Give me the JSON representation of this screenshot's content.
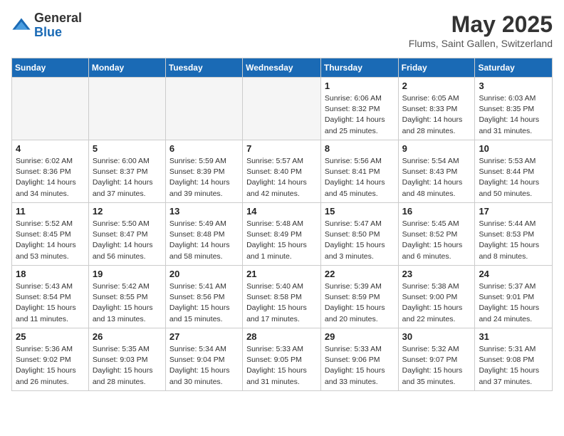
{
  "logo": {
    "general": "General",
    "blue": "Blue"
  },
  "title": "May 2025",
  "location": "Flums, Saint Gallen, Switzerland",
  "weekdays": [
    "Sunday",
    "Monday",
    "Tuesday",
    "Wednesday",
    "Thursday",
    "Friday",
    "Saturday"
  ],
  "weeks": [
    [
      {
        "day": "",
        "text": ""
      },
      {
        "day": "",
        "text": ""
      },
      {
        "day": "",
        "text": ""
      },
      {
        "day": "",
        "text": ""
      },
      {
        "day": "1",
        "text": "Sunrise: 6:06 AM\nSunset: 8:32 PM\nDaylight: 14 hours and 25 minutes."
      },
      {
        "day": "2",
        "text": "Sunrise: 6:05 AM\nSunset: 8:33 PM\nDaylight: 14 hours and 28 minutes."
      },
      {
        "day": "3",
        "text": "Sunrise: 6:03 AM\nSunset: 8:35 PM\nDaylight: 14 hours and 31 minutes."
      }
    ],
    [
      {
        "day": "4",
        "text": "Sunrise: 6:02 AM\nSunset: 8:36 PM\nDaylight: 14 hours and 34 minutes."
      },
      {
        "day": "5",
        "text": "Sunrise: 6:00 AM\nSunset: 8:37 PM\nDaylight: 14 hours and 37 minutes."
      },
      {
        "day": "6",
        "text": "Sunrise: 5:59 AM\nSunset: 8:39 PM\nDaylight: 14 hours and 39 minutes."
      },
      {
        "day": "7",
        "text": "Sunrise: 5:57 AM\nSunset: 8:40 PM\nDaylight: 14 hours and 42 minutes."
      },
      {
        "day": "8",
        "text": "Sunrise: 5:56 AM\nSunset: 8:41 PM\nDaylight: 14 hours and 45 minutes."
      },
      {
        "day": "9",
        "text": "Sunrise: 5:54 AM\nSunset: 8:43 PM\nDaylight: 14 hours and 48 minutes."
      },
      {
        "day": "10",
        "text": "Sunrise: 5:53 AM\nSunset: 8:44 PM\nDaylight: 14 hours and 50 minutes."
      }
    ],
    [
      {
        "day": "11",
        "text": "Sunrise: 5:52 AM\nSunset: 8:45 PM\nDaylight: 14 hours and 53 minutes."
      },
      {
        "day": "12",
        "text": "Sunrise: 5:50 AM\nSunset: 8:47 PM\nDaylight: 14 hours and 56 minutes."
      },
      {
        "day": "13",
        "text": "Sunrise: 5:49 AM\nSunset: 8:48 PM\nDaylight: 14 hours and 58 minutes."
      },
      {
        "day": "14",
        "text": "Sunrise: 5:48 AM\nSunset: 8:49 PM\nDaylight: 15 hours and 1 minute."
      },
      {
        "day": "15",
        "text": "Sunrise: 5:47 AM\nSunset: 8:50 PM\nDaylight: 15 hours and 3 minutes."
      },
      {
        "day": "16",
        "text": "Sunrise: 5:45 AM\nSunset: 8:52 PM\nDaylight: 15 hours and 6 minutes."
      },
      {
        "day": "17",
        "text": "Sunrise: 5:44 AM\nSunset: 8:53 PM\nDaylight: 15 hours and 8 minutes."
      }
    ],
    [
      {
        "day": "18",
        "text": "Sunrise: 5:43 AM\nSunset: 8:54 PM\nDaylight: 15 hours and 11 minutes."
      },
      {
        "day": "19",
        "text": "Sunrise: 5:42 AM\nSunset: 8:55 PM\nDaylight: 15 hours and 13 minutes."
      },
      {
        "day": "20",
        "text": "Sunrise: 5:41 AM\nSunset: 8:56 PM\nDaylight: 15 hours and 15 minutes."
      },
      {
        "day": "21",
        "text": "Sunrise: 5:40 AM\nSunset: 8:58 PM\nDaylight: 15 hours and 17 minutes."
      },
      {
        "day": "22",
        "text": "Sunrise: 5:39 AM\nSunset: 8:59 PM\nDaylight: 15 hours and 20 minutes."
      },
      {
        "day": "23",
        "text": "Sunrise: 5:38 AM\nSunset: 9:00 PM\nDaylight: 15 hours and 22 minutes."
      },
      {
        "day": "24",
        "text": "Sunrise: 5:37 AM\nSunset: 9:01 PM\nDaylight: 15 hours and 24 minutes."
      }
    ],
    [
      {
        "day": "25",
        "text": "Sunrise: 5:36 AM\nSunset: 9:02 PM\nDaylight: 15 hours and 26 minutes."
      },
      {
        "day": "26",
        "text": "Sunrise: 5:35 AM\nSunset: 9:03 PM\nDaylight: 15 hours and 28 minutes."
      },
      {
        "day": "27",
        "text": "Sunrise: 5:34 AM\nSunset: 9:04 PM\nDaylight: 15 hours and 30 minutes."
      },
      {
        "day": "28",
        "text": "Sunrise: 5:33 AM\nSunset: 9:05 PM\nDaylight: 15 hours and 31 minutes."
      },
      {
        "day": "29",
        "text": "Sunrise: 5:33 AM\nSunset: 9:06 PM\nDaylight: 15 hours and 33 minutes."
      },
      {
        "day": "30",
        "text": "Sunrise: 5:32 AM\nSunset: 9:07 PM\nDaylight: 15 hours and 35 minutes."
      },
      {
        "day": "31",
        "text": "Sunrise: 5:31 AM\nSunset: 9:08 PM\nDaylight: 15 hours and 37 minutes."
      }
    ]
  ]
}
